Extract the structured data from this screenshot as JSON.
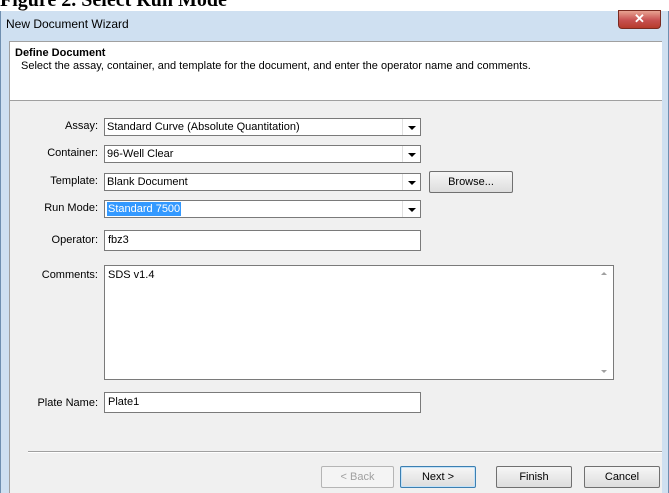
{
  "caption": "Figure 2. Select Run Mode",
  "window": {
    "title": "New Document Wizard",
    "close_glyph": "✕"
  },
  "header": {
    "title": "Define Document",
    "description": "Select the assay, container, and template for the document, and enter the operator name and comments."
  },
  "form": {
    "assay_label": "Assay:",
    "assay_value": "Standard Curve (Absolute Quantitation)",
    "container_label": "Container:",
    "container_value": "96-Well Clear",
    "template_label": "Template:",
    "template_value": "Blank Document",
    "browse_label": "Browse...",
    "run_mode_label": "Run Mode:",
    "run_mode_value": "Standard 7500",
    "operator_label": "Operator:",
    "operator_value": "fbz3",
    "comments_label": "Comments:",
    "comments_value": "SDS v1.4",
    "plate_name_label": "Plate Name:",
    "plate_name_value": "Plate1"
  },
  "buttons": {
    "back": "< Back",
    "next": "Next >",
    "finish": "Finish",
    "cancel": "Cancel"
  },
  "icons": [
    "close-icon",
    "dropdown-arrow-icon",
    "scroll-up-icon",
    "scroll-down-icon"
  ]
}
